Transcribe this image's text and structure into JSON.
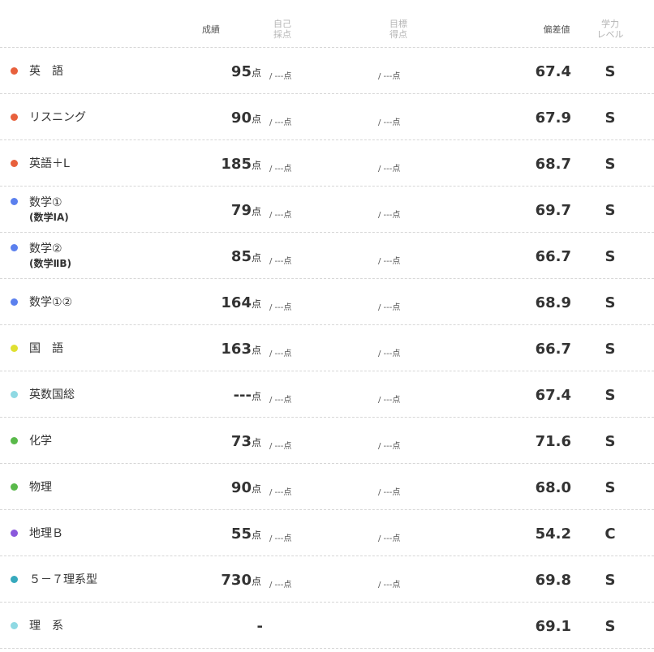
{
  "header": {
    "score": "成績",
    "self": "自己\n採点",
    "target": "目標\n得点",
    "deviation": "偏差値",
    "level": "学力\nレベル"
  },
  "rows": [
    {
      "name": "英　語",
      "sub": "",
      "color": "#e8603c",
      "score": "95",
      "unit": "点",
      "self": "/ ---点",
      "target": "/ ---点",
      "deviation": "67.4",
      "level": "S"
    },
    {
      "name": "リスニング",
      "sub": "",
      "color": "#e8603c",
      "score": "90",
      "unit": "点",
      "self": "/ ---点",
      "target": "/ ---点",
      "deviation": "67.9",
      "level": "S"
    },
    {
      "name": "英語＋L",
      "sub": "",
      "color": "#e8603c",
      "score": "185",
      "unit": "点",
      "self": "/ ---点",
      "target": "/ ---点",
      "deviation": "68.7",
      "level": "S"
    },
    {
      "name": "数学①",
      "sub": "(数学ⅠA)",
      "color": "#5b80ee",
      "score": "79",
      "unit": "点",
      "self": "/ ---点",
      "target": "/ ---点",
      "deviation": "69.7",
      "level": "S"
    },
    {
      "name": "数学②",
      "sub": "(数学ⅡB)",
      "color": "#5b80ee",
      "score": "85",
      "unit": "点",
      "self": "/ ---点",
      "target": "/ ---点",
      "deviation": "66.7",
      "level": "S"
    },
    {
      "name": "数学①②",
      "sub": "",
      "color": "#5b80ee",
      "score": "164",
      "unit": "点",
      "self": "/ ---点",
      "target": "/ ---点",
      "deviation": "68.9",
      "level": "S"
    },
    {
      "name": "国　語",
      "sub": "",
      "color": "#dfe031",
      "score": "163",
      "unit": "点",
      "self": "/ ---点",
      "target": "/ ---点",
      "deviation": "66.7",
      "level": "S"
    },
    {
      "name": "英数国総",
      "sub": "",
      "color": "#8fd9e3",
      "score": "---",
      "unit": "点",
      "self": "/ ---点",
      "target": "/ ---点",
      "deviation": "67.4",
      "level": "S"
    },
    {
      "name": "化学",
      "sub": "",
      "color": "#59b94a",
      "score": "73",
      "unit": "点",
      "self": "/ ---点",
      "target": "/ ---点",
      "deviation": "71.6",
      "level": "S"
    },
    {
      "name": "物理",
      "sub": "",
      "color": "#59b94a",
      "score": "90",
      "unit": "点",
      "self": "/ ---点",
      "target": "/ ---点",
      "deviation": "68.0",
      "level": "S"
    },
    {
      "name": "地理Ｂ",
      "sub": "",
      "color": "#8a58dc",
      "score": "55",
      "unit": "点",
      "self": "/ ---点",
      "target": "/ ---点",
      "deviation": "54.2",
      "level": "C"
    },
    {
      "name": "５－７理系型",
      "sub": "",
      "color": "#36a9bd",
      "score": "730",
      "unit": "点",
      "self": "/ ---点",
      "target": "/ ---点",
      "deviation": "69.8",
      "level": "S"
    },
    {
      "name": "理　系",
      "sub": "",
      "color": "#8fd9e3",
      "score": "-",
      "unit": "",
      "self": "",
      "target": "",
      "deviation": "69.1",
      "level": "S"
    }
  ]
}
